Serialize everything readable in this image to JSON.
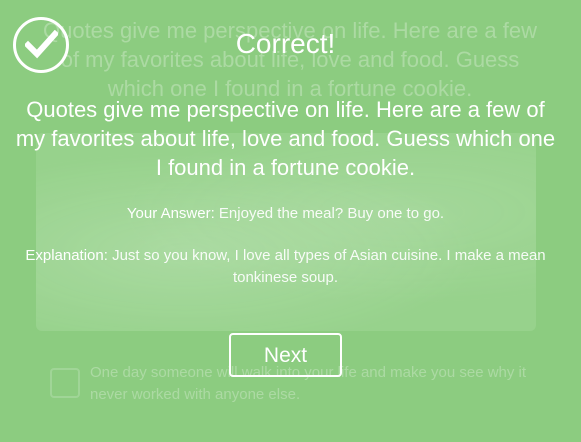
{
  "background": {
    "question_text": "Quotes give me perspective on life. Here are a few of my favorites about life, love and food. Guess which one I found in a fortune cookie.",
    "option_text": "One day someone will walk into your life and make you see why it never worked with anyone else."
  },
  "result": {
    "icon": "checkmark-icon",
    "title": "Correct!",
    "question": "Quotes give me perspective on life. Here are a few of my favorites about life, love and food. Guess which one I found in a fortune cookie.",
    "answer_label": "Your Answer:",
    "answer_value": "Enjoyed the meal? Buy one to go.",
    "explanation_label": "Explanation:",
    "explanation_value": "Just so you know, I love all types of Asian cuisine. I make a mean tonkinese soup.",
    "next_label": "Next"
  },
  "colors": {
    "background": "#8ecf83",
    "text": "#ffffff"
  }
}
